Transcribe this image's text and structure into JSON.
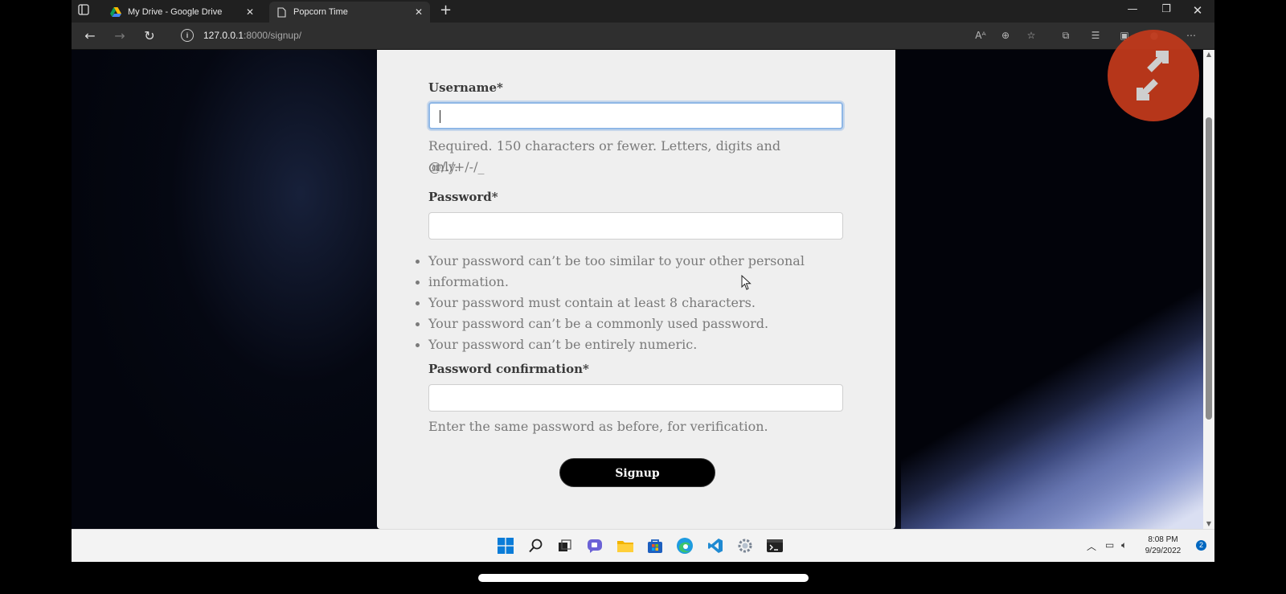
{
  "browser": {
    "tabs": [
      {
        "label": "My Drive - Google Drive",
        "icon": "google-drive-icon"
      },
      {
        "label": "Popcorn Time",
        "icon": "page-icon"
      }
    ],
    "url_host": "127.0.0.1",
    "url_path": ":8000/signup/"
  },
  "form": {
    "username_label": "Username*",
    "username_help_line1": "Required. 150 characters or fewer. Letters, digits and @/./+/-/_",
    "username_help_line2": "only.",
    "password_label": "Password*",
    "password_rules": [
      "Your password can’t be too similar to your other personal",
      "information.",
      "Your password must contain at least 8 characters.",
      "Your password can’t be a commonly used password.",
      "Your password can’t be entirely numeric."
    ],
    "confirm_label": "Password confirmation*",
    "confirm_help": "Enter the same password as before, for verification.",
    "signup_label": "Signup"
  },
  "taskbar": {
    "time": "8:08 PM",
    "date": "9/29/2022",
    "notifications": "2"
  },
  "colors": {
    "card_bg": "#efefef",
    "button_bg": "#000000",
    "remote_badge": "#c0391b",
    "focus_ring": "#8fb7e6"
  }
}
